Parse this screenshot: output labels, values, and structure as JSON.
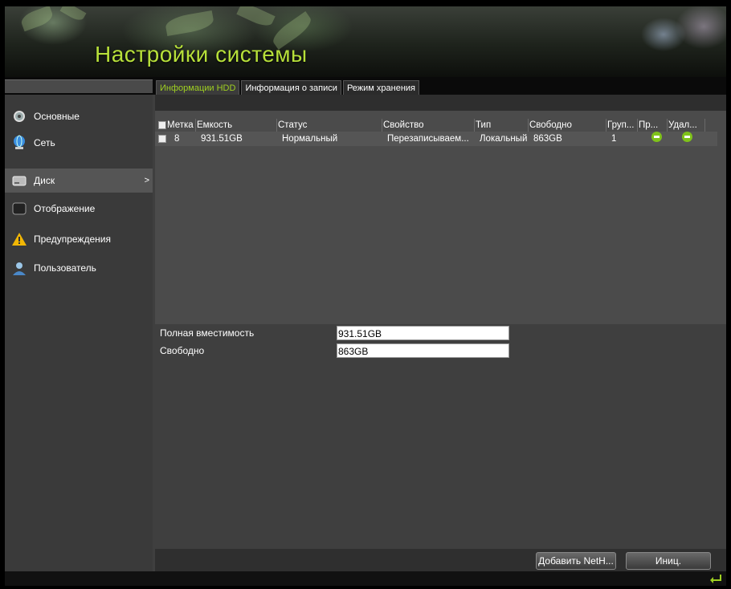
{
  "header": {
    "title": "Настройки системы"
  },
  "tabs": [
    {
      "label": "Информации HDD",
      "active": true
    },
    {
      "label": "Информация о записи",
      "active": false
    },
    {
      "label": "Режим хранения",
      "active": false
    }
  ],
  "sidebar": {
    "items": [
      {
        "label": "Основные",
        "icon": "settings-icon"
      },
      {
        "label": "Сеть",
        "icon": "network-globe-icon"
      },
      {
        "label": "Диск",
        "icon": "hdd-icon",
        "selected": true,
        "chevron": ">"
      },
      {
        "label": "Отображение",
        "icon": "monitor-icon"
      },
      {
        "label": "Предупреждения",
        "icon": "warning-icon"
      },
      {
        "label": "Пользователь",
        "icon": "user-icon"
      }
    ]
  },
  "table": {
    "columns": [
      "Метка",
      "Емкость",
      "Статус",
      "Свойство",
      "Тип",
      "Свободно",
      "Груп...",
      "Пр...",
      "Удал..."
    ],
    "rows": [
      {
        "label": "8",
        "capacity": "931.51GB",
        "status": "Нормальный",
        "property": "Перезаписываем...",
        "type": "Локальный",
        "free": "863GB",
        "group": "1",
        "edit_icon": "ok-green-icon",
        "delete_icon": "ok-green-icon"
      }
    ]
  },
  "summary": {
    "total_label": "Полная вместимость",
    "total_value": "931.51GB",
    "free_label": "Свободно",
    "free_value": "863GB"
  },
  "buttons": {
    "add_nethdd": "Добавить NetH...",
    "init": "Иниц."
  },
  "colors": {
    "accent": "#9fd021",
    "title": "#b7e03a",
    "status_ok": "#7fc21a"
  }
}
